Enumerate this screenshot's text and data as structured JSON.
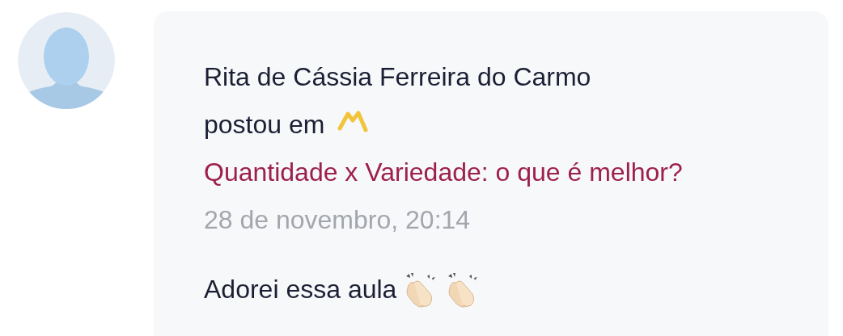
{
  "post": {
    "author": "Rita de Cássia Ferreira do Carmo",
    "action": "postou em",
    "topic": "Quantidade x Variedade: o que é melhor?",
    "date": "28 de novembro, 20:14",
    "message": "Adorei essa aula",
    "reactions": [
      {
        "kind": "clap"
      },
      {
        "kind": "clap"
      }
    ]
  }
}
